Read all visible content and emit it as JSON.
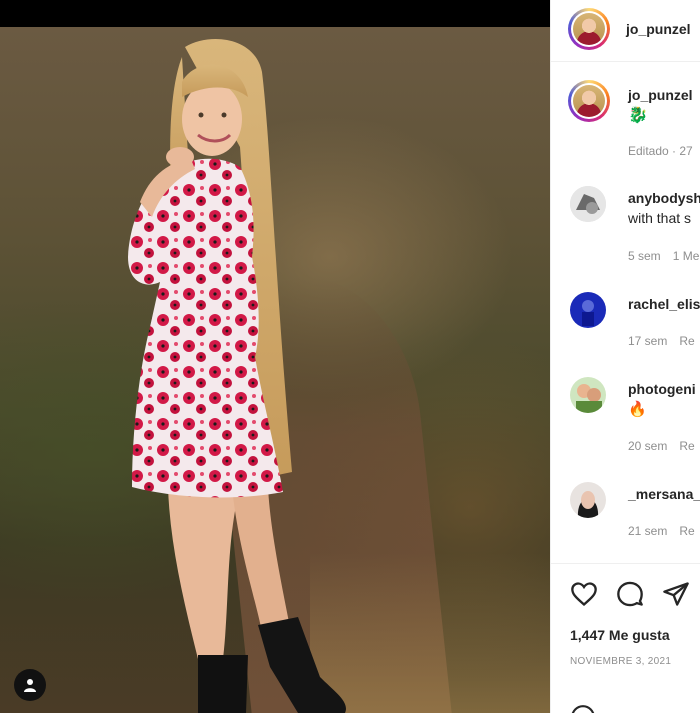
{
  "post": {
    "author": "jo_punzel",
    "caption_emoji": "🐉",
    "edited_label": "Editado · 27",
    "likes_text": "1,447 Me gusta",
    "date_text": "NOVIEMBRE 3, 2021"
  },
  "comments": [
    {
      "user": "anybodysh",
      "text": "with that s",
      "time": "5 sem",
      "extra": "1 Me"
    },
    {
      "user": "rachel_elis",
      "text": "",
      "time": "17 sem",
      "extra": "Re"
    },
    {
      "user": "photogeni",
      "text": "🔥",
      "time": "20 sem",
      "extra": "Re"
    },
    {
      "user": "_mersana_",
      "text": "",
      "time": "21 sem",
      "extra": "Re"
    }
  ],
  "icons": {
    "like": "heart-icon",
    "comment": "comment-icon",
    "share": "share-icon",
    "profile": "user-icon",
    "caption": "dragon-emoji"
  },
  "colors": {
    "text": "#262626",
    "muted": "#8e8e8e",
    "divider": "#efefef"
  }
}
